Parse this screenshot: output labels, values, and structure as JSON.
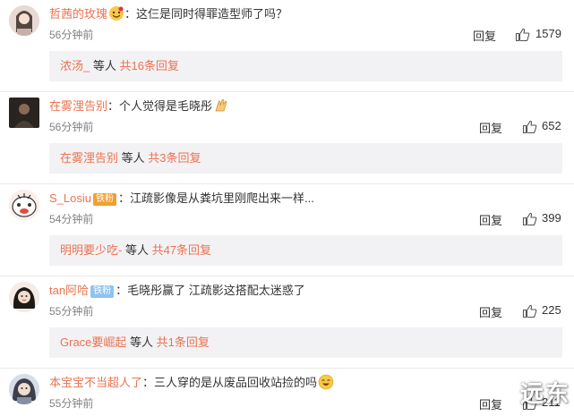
{
  "comments": [
    {
      "username": "哲茜的玫瑰",
      "badge": "",
      "text": "：这仨是同时得罪造型师了吗？",
      "time": "56分钟前",
      "reply_label": "回复",
      "likes": "1579",
      "reply_user": "浓汤_",
      "reply_mid": " 等人 ",
      "reply_count": "共16条回复"
    },
    {
      "username": "在雾浬告别",
      "badge": "",
      "text": "：个人觉得是毛晓彤",
      "time": "56分钟前",
      "reply_label": "回复",
      "likes": "652",
      "reply_user": "在雾浬告别",
      "reply_mid": " 等人 ",
      "reply_count": "共3条回复"
    },
    {
      "username": "S_Losiu",
      "badge": "铁粉",
      "text": "：江疏影像是从粪坑里刚爬出来一样...",
      "time": "54分钟前",
      "reply_label": "回复",
      "likes": "399",
      "reply_user": "明明要少吃-",
      "reply_mid": " 等人 ",
      "reply_count": "共47条回复"
    },
    {
      "username": "tan阿哈",
      "badge": "铁粉",
      "text": "：毛晓彤赢了   江疏影这搭配太迷惑了",
      "time": "55分钟前",
      "reply_label": "回复",
      "likes": "225",
      "reply_user": "Grace要崛起",
      "reply_mid": " 等人 ",
      "reply_count": "共1条回复"
    },
    {
      "username": "本宝宝不当超人了",
      "badge": "",
      "text": "：三人穿的是从废品回收站捡的吗",
      "time": "55分钟前",
      "reply_label": "回复",
      "likes": "211",
      "reply_user": "",
      "reply_mid": "",
      "reply_count": ""
    }
  ],
  "watermark": "远东",
  "colors": {
    "username": "#eb7350",
    "reply_box_bg": "#f2f2f5",
    "time": "#808080"
  },
  "icons": {
    "like": "thumbs-up-icon",
    "emoji_1": "rose-emoji-icon",
    "emoji_2": "clapping-hands-emoji-icon",
    "emoji_5": "laughing-emoji-icon"
  }
}
